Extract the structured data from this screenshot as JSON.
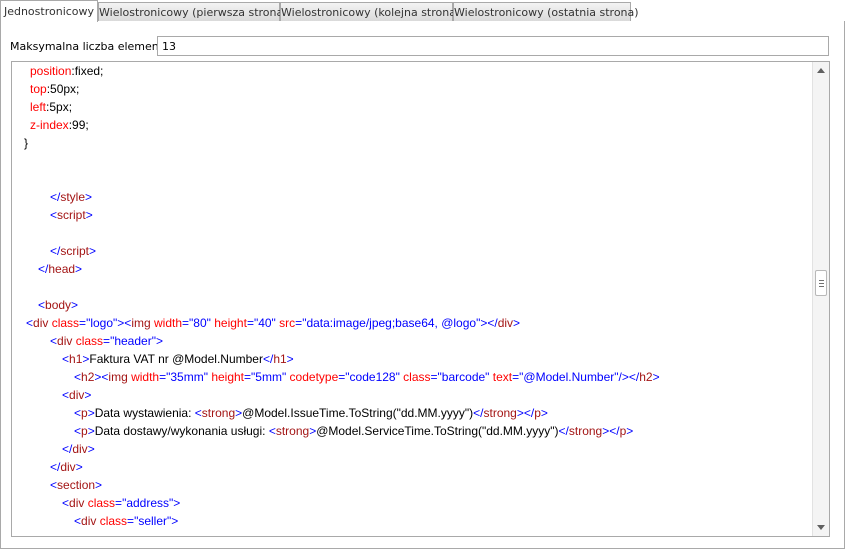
{
  "tabs": [
    {
      "label": "Jednostronicowy",
      "active": true
    },
    {
      "label": "Wielostronicowy (pierwsza strona)",
      "active": false
    },
    {
      "label": "Wielostronicowy (kolejna strona)",
      "active": false
    },
    {
      "label": "Wielostronicowy (ostatnia strona)",
      "active": false
    }
  ],
  "max_items": {
    "label": "Maksymalna liczba elementów",
    "value": "13"
  },
  "colors": {
    "tag": "#0000ff",
    "attribute": "#ff0000",
    "element_name": "#a31515",
    "text": "#000000"
  },
  "code_lines": [
    {
      "indent": 0,
      "tokens": [
        [
          "at",
          "position"
        ],
        [
          "tx",
          ":fixed;"
        ]
      ]
    },
    {
      "indent": 0,
      "tokens": [
        [
          "at",
          "top"
        ],
        [
          "tx",
          ":50px;"
        ]
      ]
    },
    {
      "indent": 0,
      "tokens": [
        [
          "at",
          "left"
        ],
        [
          "tx",
          ":5px;"
        ]
      ]
    },
    {
      "indent": 0,
      "tokens": [
        [
          "at",
          "z-index"
        ],
        [
          "tx",
          ":99;"
        ]
      ]
    },
    {
      "indent": 0,
      "tokens": [
        [
          "tx",
          "}"
        ]
      ]
    },
    {
      "indent": 0,
      "tokens": []
    },
    {
      "indent": 0,
      "tokens": []
    },
    {
      "indent": 0,
      "tokens": [
        [
          "kw",
          "</"
        ],
        [
          "nm",
          "style"
        ],
        [
          "kw",
          ">"
        ]
      ]
    },
    {
      "indent": 0,
      "tokens": [
        [
          "kw",
          "<"
        ],
        [
          "nm",
          "script"
        ],
        [
          "kw",
          ">"
        ]
      ]
    },
    {
      "indent": 0,
      "tokens": []
    },
    {
      "indent": 0,
      "tokens": [
        [
          "kw",
          "</"
        ],
        [
          "nm",
          "script"
        ],
        [
          "kw",
          ">"
        ]
      ]
    },
    {
      "indent": 0,
      "tokens": [
        [
          "kw",
          "</"
        ],
        [
          "nm",
          "head"
        ],
        [
          "kw",
          ">"
        ]
      ]
    },
    {
      "indent": 0,
      "tokens": []
    },
    {
      "indent": 0,
      "tokens": [
        [
          "kw",
          "<"
        ],
        [
          "nm",
          "body"
        ],
        [
          "kw",
          ">"
        ]
      ]
    },
    {
      "indent": 0,
      "tokens": [
        [
          "kw",
          "<"
        ],
        [
          "nm",
          "div"
        ],
        [
          "at",
          " class"
        ],
        [
          "kw",
          "="
        ],
        [
          "kw",
          "\"logo\""
        ],
        [
          "kw",
          ">"
        ],
        [
          "kw",
          "<"
        ],
        [
          "nm",
          "img"
        ],
        [
          "at",
          " width"
        ],
        [
          "kw",
          "="
        ],
        [
          "kw",
          "\"80\""
        ],
        [
          "at",
          " height"
        ],
        [
          "kw",
          "="
        ],
        [
          "kw",
          "\"40\""
        ],
        [
          "at",
          " src"
        ],
        [
          "kw",
          "="
        ],
        [
          "kw",
          "\"data:image/jpeg;base64, @logo\""
        ],
        [
          "kw",
          ">"
        ],
        [
          "kw",
          "</"
        ],
        [
          "nm",
          "div"
        ],
        [
          "kw",
          ">"
        ]
      ]
    },
    {
      "indent": 0,
      "tokens": [
        [
          "kw",
          "<"
        ],
        [
          "nm",
          "div"
        ],
        [
          "at",
          " class"
        ],
        [
          "kw",
          "="
        ],
        [
          "kw",
          "\"header\""
        ],
        [
          "kw",
          ">"
        ]
      ]
    },
    {
      "indent": 0,
      "tokens": [
        [
          "kw",
          "<"
        ],
        [
          "nm",
          "h1"
        ],
        [
          "kw",
          ">"
        ],
        [
          "tx",
          "Faktura VAT nr @Model.Number"
        ],
        [
          "kw",
          "</"
        ],
        [
          "nm",
          "h1"
        ],
        [
          "kw",
          ">"
        ]
      ]
    },
    {
      "indent": 0,
      "tokens": [
        [
          "kw",
          "<"
        ],
        [
          "nm",
          "h2"
        ],
        [
          "kw",
          ">"
        ],
        [
          "kw",
          "<"
        ],
        [
          "nm",
          "img"
        ],
        [
          "at",
          " width"
        ],
        [
          "kw",
          "="
        ],
        [
          "kw",
          "\"35mm\""
        ],
        [
          "at",
          " height"
        ],
        [
          "kw",
          "="
        ],
        [
          "kw",
          "\"5mm\""
        ],
        [
          "at",
          " codetype"
        ],
        [
          "kw",
          "="
        ],
        [
          "kw",
          "\"code128\""
        ],
        [
          "at",
          " class"
        ],
        [
          "kw",
          "="
        ],
        [
          "kw",
          "\"barcode\""
        ],
        [
          "at",
          " text"
        ],
        [
          "kw",
          "="
        ],
        [
          "kw",
          "\"@Model.Number\""
        ],
        [
          "kw",
          "/>"
        ],
        [
          "kw",
          "</"
        ],
        [
          "nm",
          "h2"
        ],
        [
          "kw",
          ">"
        ]
      ]
    },
    {
      "indent": 0,
      "tokens": [
        [
          "kw",
          "<"
        ],
        [
          "nm",
          "div"
        ],
        [
          "kw",
          ">"
        ]
      ]
    },
    {
      "indent": 0,
      "tokens": [
        [
          "kw",
          "<"
        ],
        [
          "nm",
          "p"
        ],
        [
          "kw",
          ">"
        ],
        [
          "tx",
          "Data wystawienia: "
        ],
        [
          "kw",
          "<"
        ],
        [
          "nm",
          "strong"
        ],
        [
          "kw",
          ">"
        ],
        [
          "tx",
          "@Model.IssueTime.ToString(\"dd.MM.yyyy\")"
        ],
        [
          "kw",
          "</"
        ],
        [
          "nm",
          "strong"
        ],
        [
          "kw",
          ">"
        ],
        [
          "kw",
          "</"
        ],
        [
          "nm",
          "p"
        ],
        [
          "kw",
          ">"
        ]
      ]
    },
    {
      "indent": 0,
      "tokens": [
        [
          "kw",
          "<"
        ],
        [
          "nm",
          "p"
        ],
        [
          "kw",
          ">"
        ],
        [
          "tx",
          "Data dostawy/wykonania usługi: "
        ],
        [
          "kw",
          "<"
        ],
        [
          "nm",
          "strong"
        ],
        [
          "kw",
          ">"
        ],
        [
          "tx",
          "@Model.ServiceTime.ToString(\"dd.MM.yyyy\")"
        ],
        [
          "kw",
          "</"
        ],
        [
          "nm",
          "strong"
        ],
        [
          "kw",
          ">"
        ],
        [
          "kw",
          "</"
        ],
        [
          "nm",
          "p"
        ],
        [
          "kw",
          ">"
        ]
      ]
    },
    {
      "indent": 0,
      "tokens": [
        [
          "kw",
          "</"
        ],
        [
          "nm",
          "div"
        ],
        [
          "kw",
          ">"
        ]
      ]
    },
    {
      "indent": 0,
      "tokens": [
        [
          "kw",
          "</"
        ],
        [
          "nm",
          "div"
        ],
        [
          "kw",
          ">"
        ]
      ]
    },
    {
      "indent": 0,
      "tokens": [
        [
          "kw",
          "<"
        ],
        [
          "nm",
          "section"
        ],
        [
          "kw",
          ">"
        ]
      ]
    },
    {
      "indent": 0,
      "tokens": [
        [
          "kw",
          "<"
        ],
        [
          "nm",
          "div"
        ],
        [
          "at",
          " class"
        ],
        [
          "kw",
          "="
        ],
        [
          "kw",
          "\"address\""
        ],
        [
          "kw",
          ">"
        ]
      ]
    },
    {
      "indent": 0,
      "tokens": [
        [
          "kw",
          "<"
        ],
        [
          "nm",
          "div"
        ],
        [
          "at",
          " class"
        ],
        [
          "kw",
          "="
        ],
        [
          "kw",
          "\"seller\""
        ],
        [
          "kw",
          ">"
        ]
      ]
    }
  ]
}
